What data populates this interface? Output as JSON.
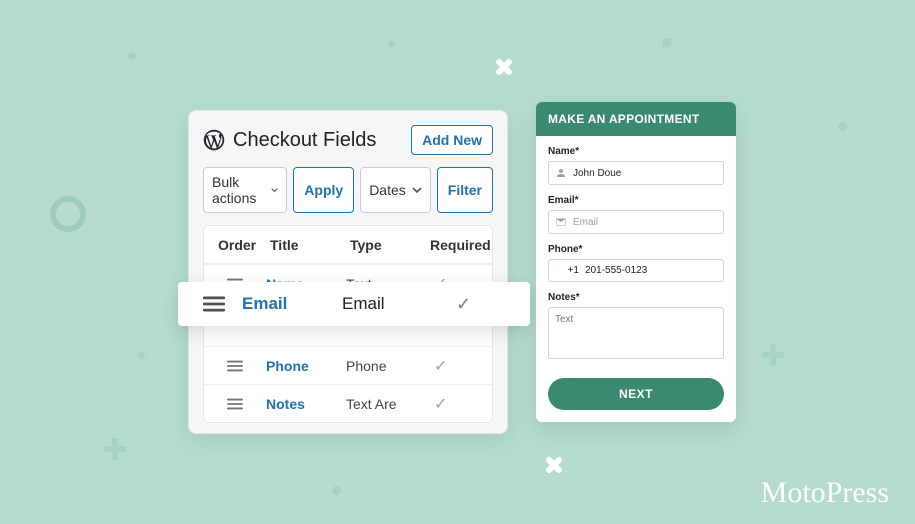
{
  "admin": {
    "title": "Checkout Fields",
    "add_new": "Add New",
    "bulk_label": "Bulk actions",
    "apply": "Apply",
    "dates_label": "Dates",
    "filter": "Filter",
    "columns": {
      "order": "Order",
      "title": "Title",
      "type": "Type",
      "required": "Required"
    },
    "rows": [
      {
        "title": "Name",
        "type": "Text"
      },
      {
        "title": "Email",
        "type": "Email"
      },
      {
        "title": "Phone",
        "type": "Phone"
      },
      {
        "title": "Notes",
        "type": "Text Are"
      }
    ]
  },
  "highlight": {
    "title": "Email",
    "type": "Email"
  },
  "form": {
    "header": "MAKE AN APPOINTMENT",
    "name_label": "Name*",
    "name_value": "John Doue",
    "email_label": "Email*",
    "email_placeholder": "Email",
    "phone_label": "Phone*",
    "phone_prefix": "+1",
    "phone_value": "201-555-0123",
    "notes_label": "Notes*",
    "notes_placeholder": "Text",
    "next": "NEXT"
  },
  "brand": "MotoPress"
}
